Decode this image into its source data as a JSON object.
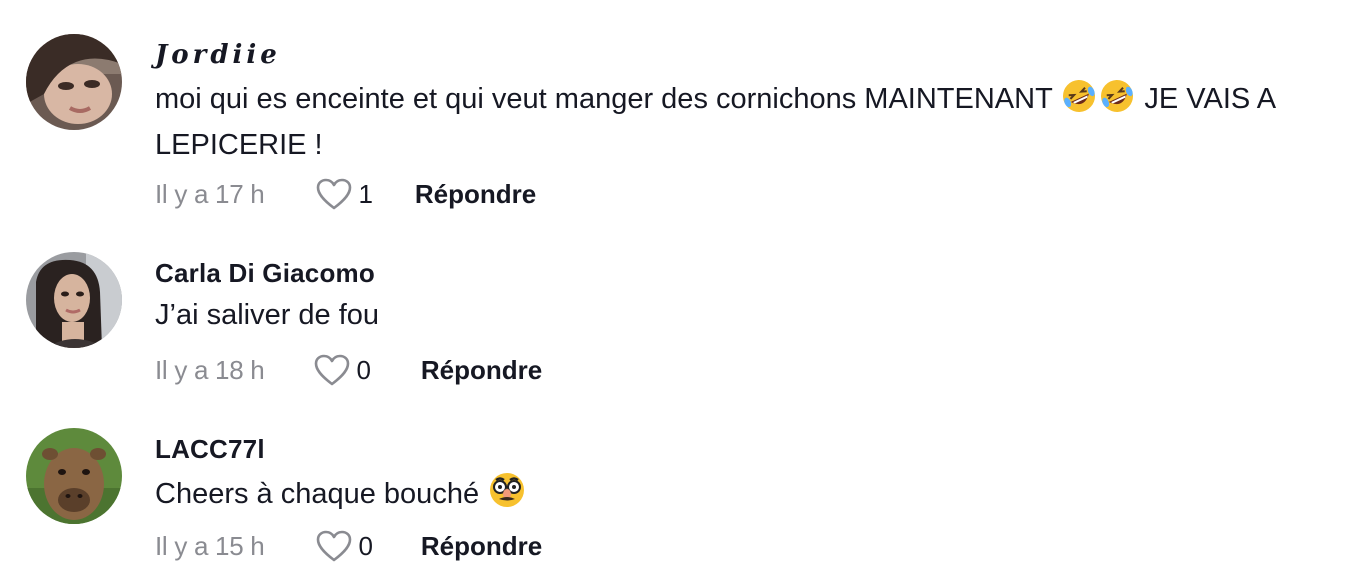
{
  "comments": [
    {
      "username": "𝑱𝒐𝒓𝒅𝒊𝒊𝒆",
      "text_before": "moi qui es enceinte et qui veut manger des cornichons MAINTENANT ",
      "emojis": [
        "rolling-on-floor-laughing-emoji",
        "rolling-on-floor-laughing-emoji"
      ],
      "text_after": " JE VAIS A LEPICERIE !",
      "time": "Il y a 17 h",
      "likes": "1",
      "reply_label": "Répondre",
      "avatar": "avatar-photo-woman-dark-hair"
    },
    {
      "username": "Carla Di Giacomo",
      "text_before": "J’ai saliver de fou",
      "emojis": [],
      "text_after": "",
      "time": "Il y a 18 h",
      "likes": "0",
      "reply_label": "Répondre",
      "avatar": "avatar-photo-woman-long-hair"
    },
    {
      "username": "LACC77l",
      "text_before": "Cheers à chaque bouché ",
      "emojis": [
        "disguised-face-emoji"
      ],
      "text_after": "",
      "time": "Il y a 15 h",
      "likes": "0",
      "reply_label": "Répondre",
      "avatar": "avatar-photo-capybara"
    }
  ],
  "colors": {
    "text": "#161823",
    "secondary": "#8a8b91",
    "heart_outline": "#8a8b91",
    "emoji_yellow": "#f7c12e"
  },
  "icons": {
    "like": "heart-outline-icon"
  }
}
